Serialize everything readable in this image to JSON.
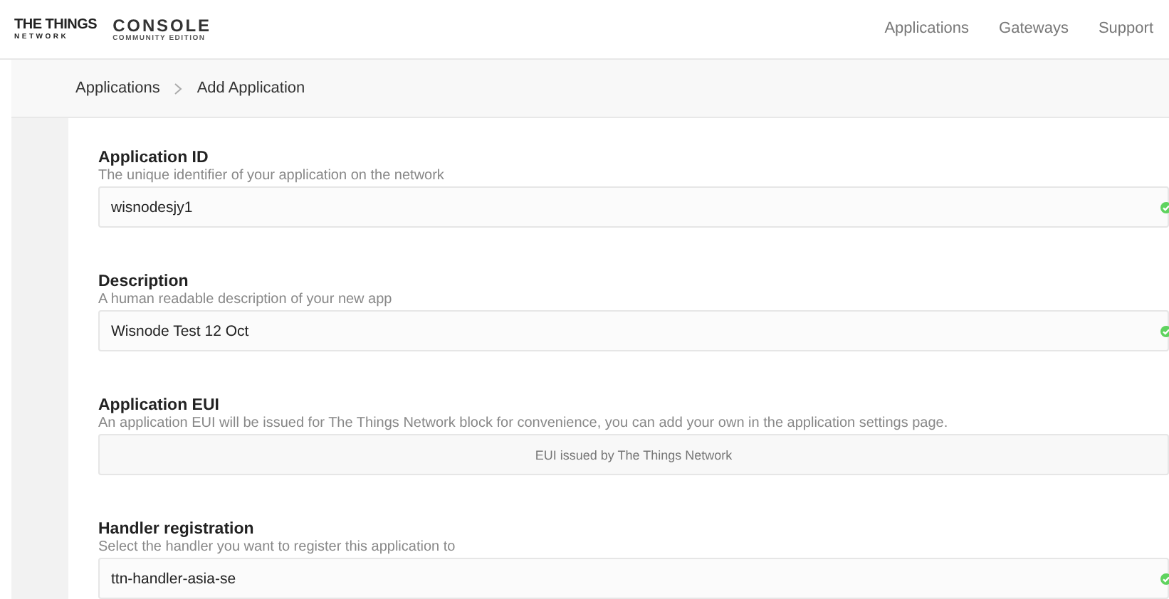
{
  "header": {
    "logo_top": "THE THINGS",
    "logo_bottom": "NETWORK",
    "console": "CONSOLE",
    "edition": "COMMUNITY EDITION",
    "nav": [
      "Applications",
      "Gateways",
      "Support"
    ]
  },
  "breadcrumb": [
    "Applications",
    "Add Application"
  ],
  "fields": [
    {
      "kind": "input",
      "label": "Application ID",
      "hint": "The unique identifier of your application on the network",
      "value": "wisnodesjy1",
      "valid": true
    },
    {
      "kind": "input",
      "label": "Description",
      "hint": "A human readable description of your new app",
      "value": "Wisnode Test 12 Oct",
      "valid": true
    },
    {
      "kind": "readonly",
      "label": "Application EUI",
      "hint": "An application EUI will be issued for The Things Network block for convenience, you can add your own in the application settings page.",
      "placeholder": "EUI issued by The Things Network",
      "valid": false
    },
    {
      "kind": "input",
      "label": "Handler registration",
      "hint": "Select the handler you want to register this application to",
      "value": "ttn-handler-asia-se",
      "valid": true
    }
  ]
}
